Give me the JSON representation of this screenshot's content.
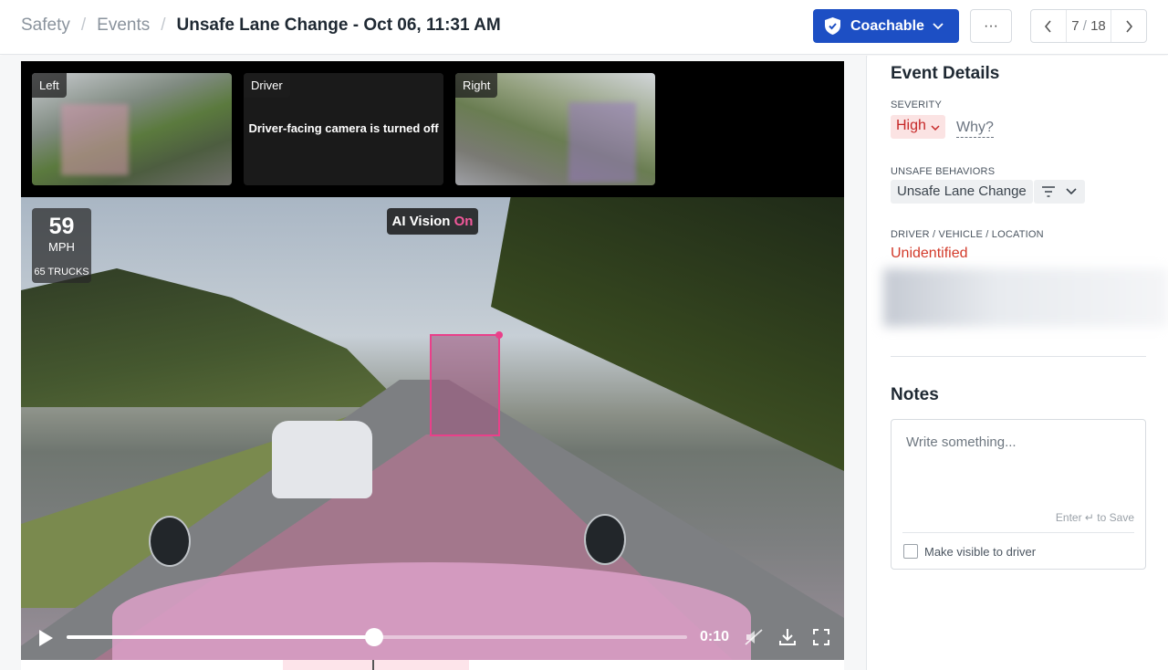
{
  "breadcrumb": {
    "safety": "Safety",
    "events": "Events",
    "separator": "/",
    "current": "Unsafe Lane Change - Oct 06, 11:31 AM"
  },
  "header": {
    "coachable_label": "Coachable",
    "more_label": "···",
    "pager_current": "7",
    "pager_slash": "/",
    "pager_total": "18",
    "accent": "#1d4fc4"
  },
  "video": {
    "cameras": [
      {
        "label": "Left"
      },
      {
        "label": "Driver",
        "message": "Driver-facing camera is turned off"
      },
      {
        "label": "Right"
      }
    ],
    "speed_value": "59",
    "speed_unit": "MPH",
    "speed_limit": "65 TRUCKS",
    "ai_vision_label": "AI Vision",
    "ai_vision_state": "On",
    "time": "0:10",
    "progress": 0.495,
    "detection_color": "#e9408a"
  },
  "details": {
    "title": "Event Details",
    "severity_label": "SEVERITY",
    "severity_value": "High",
    "severity_why": "Why?",
    "behaviors_label": "UNSAFE BEHAVIORS",
    "behavior_value": "Unsafe Lane Change",
    "dvl_label": "DRIVER / VEHICLE / LOCATION",
    "dvl_value": "Unidentified"
  },
  "notes": {
    "title": "Notes",
    "placeholder": "Write something...",
    "save_hint": "Enter ↵ to Save",
    "visible_label": "Make visible to driver",
    "visible_checked": false
  }
}
